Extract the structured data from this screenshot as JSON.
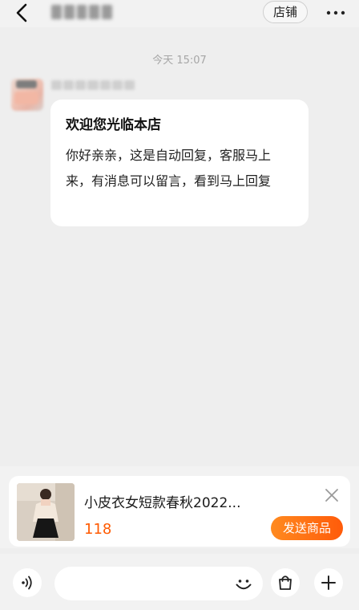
{
  "header": {
    "store_label": "店铺",
    "icons": {
      "back": "back-chevron-icon",
      "more": "more-dots-icon"
    }
  },
  "chat": {
    "time": "今天 15:07",
    "message": {
      "title": "欢迎您光临本店",
      "body": "你好亲亲，这是自动回复，客服马上来，有消息可以留言，看到马上回复"
    }
  },
  "product": {
    "title": "小皮衣女短款春秋2022...",
    "price": "118",
    "send_label": "发送商品",
    "icons": {
      "close": "close-icon"
    }
  },
  "input_bar": {
    "placeholder": "",
    "icons": {
      "voice": "voice-icon",
      "emoji": "emoji-icon",
      "bag": "shopping-bag-icon",
      "plus": "plus-icon"
    }
  },
  "colors": {
    "accent": "#ff5a00",
    "background": "#eeeeee",
    "bubble": "#ffffff"
  }
}
